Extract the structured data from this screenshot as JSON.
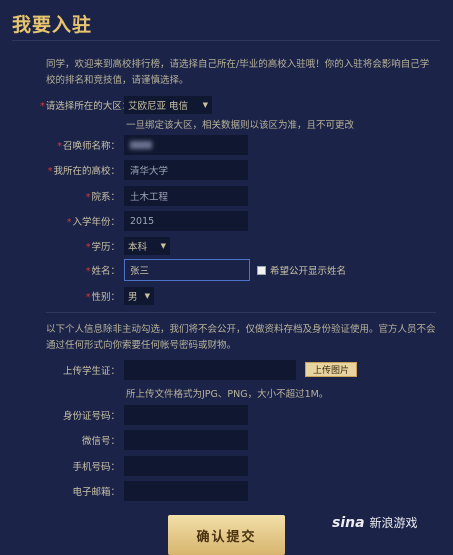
{
  "page": {
    "title": "我要入驻"
  },
  "intro": "同学，欢迎来到高校排行榜，请选择自己所在/毕业的高校入驻哦！你的入驻将会影响自己学校的排名和竞技值，请谨慎选择。",
  "form": {
    "region": {
      "label": "请选择所在的大区：",
      "value": "艾欧尼亚 电信",
      "hint": "一旦绑定该大区，相关数据则以该区为准，且不可更改"
    },
    "summoner": {
      "label": "召唤师名称：",
      "value": ""
    },
    "school": {
      "label": "我所在的高校：",
      "value": "清华大学"
    },
    "department": {
      "label": "院系：",
      "value": "土木工程"
    },
    "year": {
      "label": "入学年份：",
      "value": "2015"
    },
    "degree": {
      "label": "学历：",
      "value": "本科"
    },
    "name": {
      "label": "姓名：",
      "value": "张三",
      "public_label": "希望公开显示姓名"
    },
    "gender": {
      "label": "性别：",
      "value": "男"
    }
  },
  "privacy_note": "以下个人信息除非主动勾选，我们将不会公开，仅做资料存档及身份验证使用。官方人员不会通过任何形式向你索要任何帐号密码或财物。",
  "upload": {
    "label": "上传学生证：",
    "button": "上传图片",
    "hint": "所上传文件格式为JPG、PNG，大小不超过1M。"
  },
  "contact": {
    "id_card": {
      "label": "身份证号码：",
      "value": ""
    },
    "wechat": {
      "label": "微信号：",
      "value": ""
    },
    "phone": {
      "label": "手机号码：",
      "value": ""
    },
    "email": {
      "label": "电子邮箱：",
      "value": ""
    }
  },
  "submit": "确认提交",
  "watermark": {
    "logo": "sina",
    "text": "新浪游戏"
  }
}
